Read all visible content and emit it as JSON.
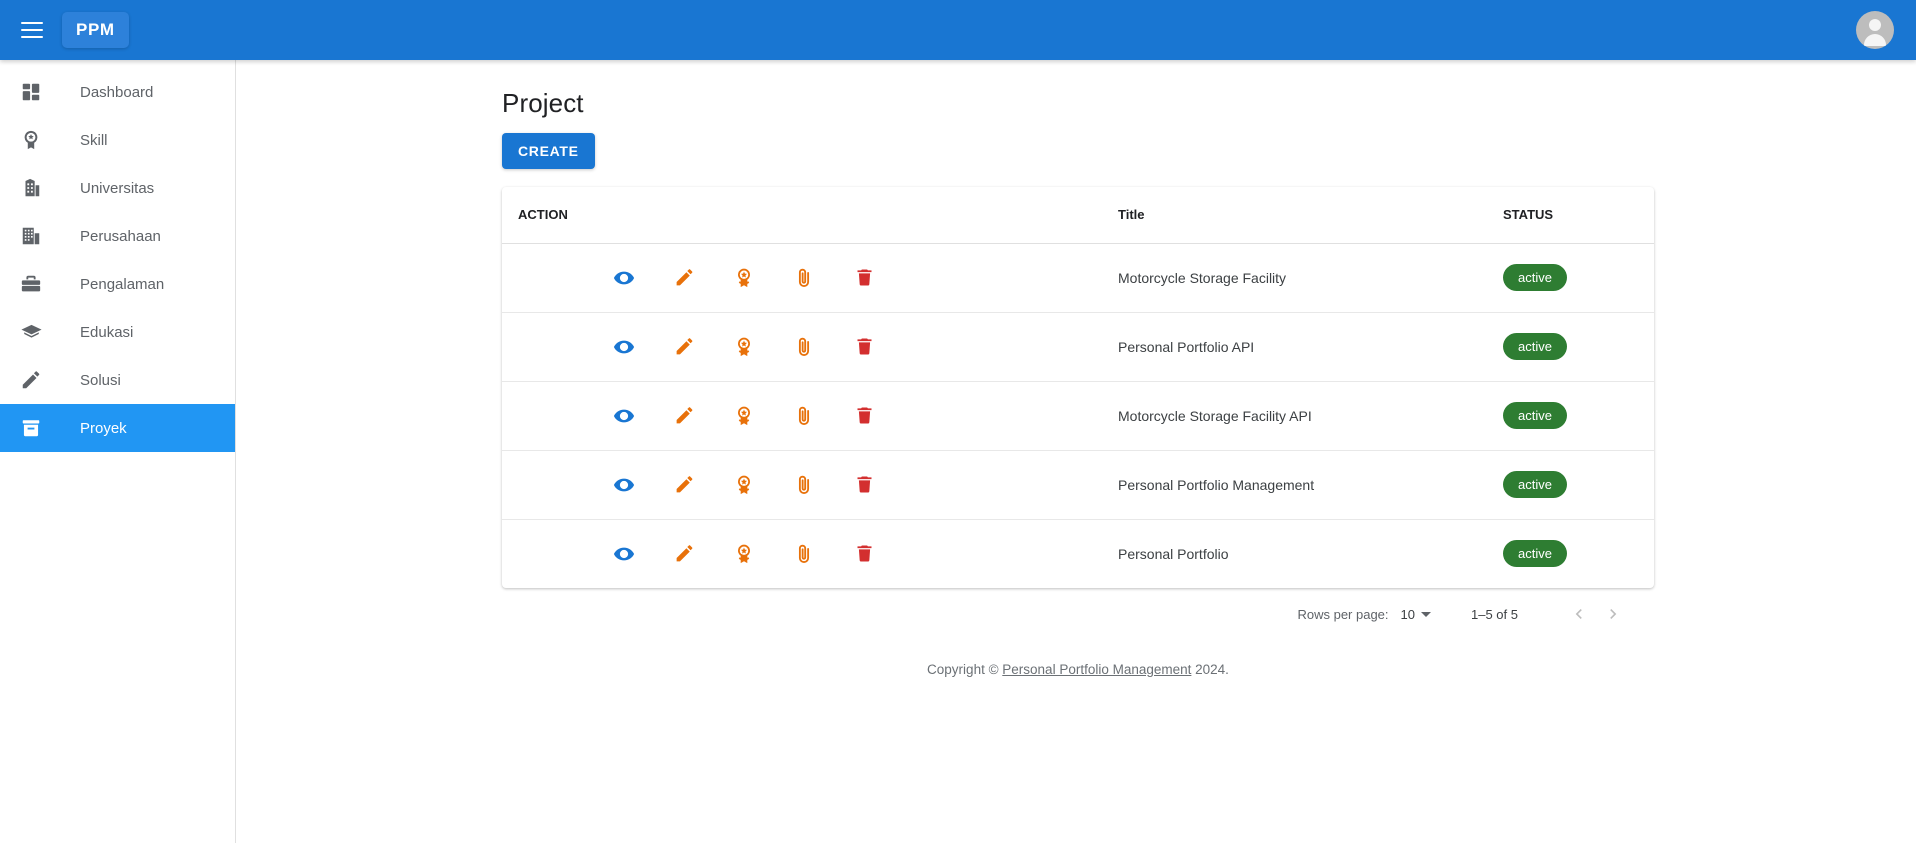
{
  "appbar": {
    "menu_icon": "hamburger-menu-icon",
    "brand": "PPM",
    "avatar_icon": "account-circle-icon",
    "background": "#1976d2"
  },
  "sidebar": {
    "items": [
      {
        "label": "Dashboard",
        "icon": "dashboard-icon",
        "active": false
      },
      {
        "label": "Skill",
        "icon": "badge-star-icon",
        "active": false
      },
      {
        "label": "Universitas",
        "icon": "school-building-icon",
        "active": false
      },
      {
        "label": "Perusahaan",
        "icon": "office-building-icon",
        "active": false
      },
      {
        "label": "Pengalaman",
        "icon": "briefcase-icon",
        "active": false
      },
      {
        "label": "Edukasi",
        "icon": "graduation-cap-icon",
        "active": false
      },
      {
        "label": "Solusi",
        "icon": "pencil-icon",
        "active": false
      },
      {
        "label": "Proyek",
        "icon": "archive-box-icon",
        "active": true
      }
    ],
    "active_color": "#2196f3"
  },
  "main": {
    "title": "Project",
    "create_label": "CREATE",
    "create_color": "#1976d2",
    "table": {
      "headers": [
        "ACTION",
        "Title",
        "STATUS"
      ],
      "row_actions": [
        {
          "name": "view-icon",
          "color": "#1976d2"
        },
        {
          "name": "edit-pencil-icon",
          "color": "#e8710a"
        },
        {
          "name": "award-badge-icon",
          "color": "#e8710a"
        },
        {
          "name": "attachment-paperclip-icon",
          "color": "#e8710a"
        },
        {
          "name": "delete-trash-icon",
          "color": "#d32f2f"
        }
      ],
      "rows": [
        {
          "title": "Motorcycle Storage Facility",
          "status": "active"
        },
        {
          "title": "Personal Portfolio API",
          "status": "active"
        },
        {
          "title": "Motorcycle Storage Facility API",
          "status": "active"
        },
        {
          "title": "Personal Portfolio Management",
          "status": "active"
        },
        {
          "title": "Personal Portfolio",
          "status": "active"
        }
      ],
      "status_color": "#2e7d32"
    },
    "pagination": {
      "rows_per_page_label": "Rows per page:",
      "rows_per_page_value": "10",
      "range_label": "1–5 of 5",
      "prev_icon": "chevron-left-icon",
      "next_icon": "chevron-right-icon"
    }
  },
  "footer": {
    "prefix": "Copyright © ",
    "link": "Personal Portfolio Management",
    "suffix": " 2024."
  }
}
